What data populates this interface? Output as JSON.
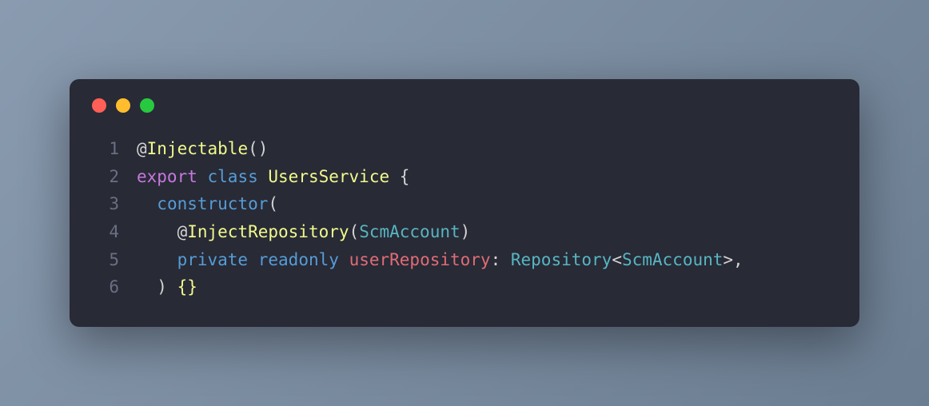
{
  "window": {
    "dots": [
      "close",
      "minimize",
      "maximize"
    ]
  },
  "code": {
    "lines": [
      {
        "n": "1",
        "tokens": [
          {
            "cls": "tok-punct",
            "t": "@"
          },
          {
            "cls": "tok-decorator",
            "t": "Injectable"
          },
          {
            "cls": "tok-punct",
            "t": "()"
          }
        ]
      },
      {
        "n": "2",
        "tokens": [
          {
            "cls": "tok-keyword",
            "t": "export"
          },
          {
            "cls": "",
            "t": " "
          },
          {
            "cls": "tok-storage",
            "t": "class"
          },
          {
            "cls": "",
            "t": " "
          },
          {
            "cls": "tok-class",
            "t": "UsersService"
          },
          {
            "cls": "",
            "t": " "
          },
          {
            "cls": "tok-punct",
            "t": "{"
          }
        ]
      },
      {
        "n": "3",
        "tokens": [
          {
            "cls": "",
            "t": "  "
          },
          {
            "cls": "tok-func",
            "t": "constructor"
          },
          {
            "cls": "tok-punct",
            "t": "("
          }
        ]
      },
      {
        "n": "4",
        "tokens": [
          {
            "cls": "",
            "t": "    "
          },
          {
            "cls": "tok-punct",
            "t": "@"
          },
          {
            "cls": "tok-decorator",
            "t": "InjectRepository"
          },
          {
            "cls": "tok-punct",
            "t": "("
          },
          {
            "cls": "tok-type",
            "t": "ScmAccount"
          },
          {
            "cls": "tok-punct",
            "t": ")"
          }
        ]
      },
      {
        "n": "5",
        "tokens": [
          {
            "cls": "",
            "t": "    "
          },
          {
            "cls": "tok-storage",
            "t": "private"
          },
          {
            "cls": "",
            "t": " "
          },
          {
            "cls": "tok-storage",
            "t": "readonly"
          },
          {
            "cls": "",
            "t": " "
          },
          {
            "cls": "tok-param",
            "t": "userRepository"
          },
          {
            "cls": "tok-punct",
            "t": ": "
          },
          {
            "cls": "tok-type",
            "t": "Repository"
          },
          {
            "cls": "tok-punct",
            "t": "<"
          },
          {
            "cls": "tok-type",
            "t": "ScmAccount"
          },
          {
            "cls": "tok-punct",
            "t": ">,"
          }
        ]
      },
      {
        "n": "6",
        "tokens": [
          {
            "cls": "",
            "t": "  "
          },
          {
            "cls": "tok-punct",
            "t": ") "
          },
          {
            "cls": "tok-brace",
            "t": "{}"
          }
        ]
      }
    ]
  }
}
